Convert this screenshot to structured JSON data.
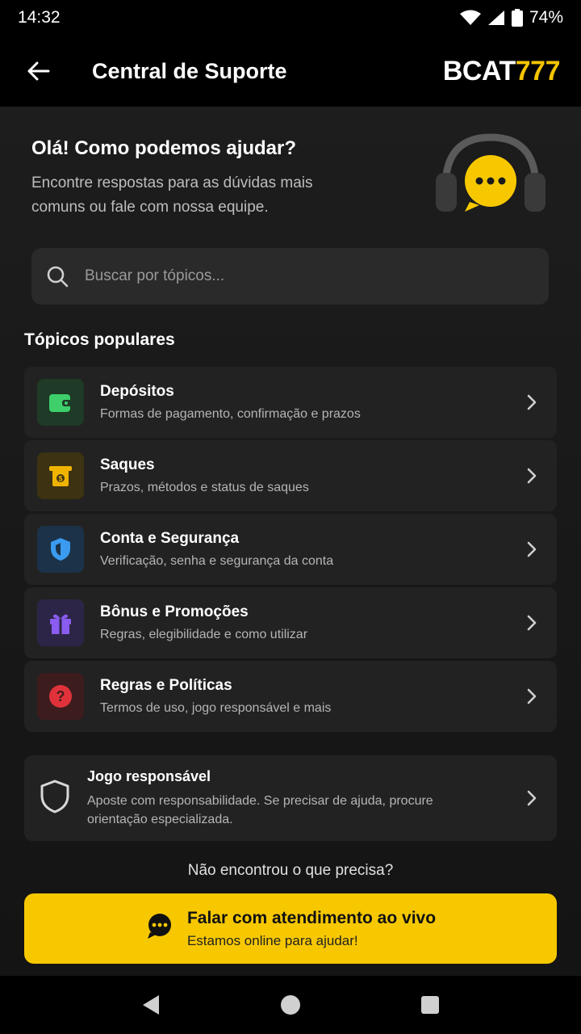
{
  "status": {
    "time": "14:32",
    "battery": "74%"
  },
  "app_bar": {
    "title": "Central de Suporte",
    "brand_prefix": "BCAT",
    "brand_suffix": "777",
    "brand_color": "#f5c400"
  },
  "hero": {
    "title": "Olá! Como podemos ajudar?",
    "subtitle": "Encontre respostas para as dúvidas mais comuns ou fale com nossa equipe.",
    "icon": "headset-chat-icon"
  },
  "search": {
    "placeholder": "Buscar por tópicos...",
    "value": ""
  },
  "topics_section": {
    "title": "Tópicos populares",
    "items": [
      {
        "title": "Depósitos",
        "description": "Formas de pagamento, confirmação e prazos",
        "icon": "wallet-icon",
        "color": "#3ecf6a",
        "bg": "#1f3a26"
      },
      {
        "title": "Saques",
        "description": "Prazos, métodos e status de saques",
        "icon": "cash-withdraw-icon",
        "color": "#f0b400",
        "bg": "#3d3211"
      },
      {
        "title": "Conta e Segurança",
        "description": "Verificação, senha e segurança da conta",
        "icon": "shield-icon",
        "color": "#3a9bf0",
        "bg": "#1b3249"
      },
      {
        "title": "Bônus e Promoções",
        "description": "Regras, elegibilidade e como utilizar",
        "icon": "gift-icon",
        "color": "#8a5cf0",
        "bg": "#2d2547"
      },
      {
        "title": "Regras e Políticas",
        "description": "Termos de uso, jogo responsável e mais",
        "icon": "question-icon",
        "color": "#e0323a",
        "bg": "#3d1c1e"
      }
    ]
  },
  "responsible": {
    "title": "Jogo responsável",
    "description": "Aposte com responsabilidade. Se precisar de ajuda, procure orientação especializada.",
    "icon": "shield-outline-icon"
  },
  "footer": {
    "not_found": "Não encontrou o que precisa?",
    "cta_title": "Falar com atendimento ao vivo",
    "cta_subtitle": "Estamos online para ajudar!",
    "cta_color": "#f7c800"
  }
}
